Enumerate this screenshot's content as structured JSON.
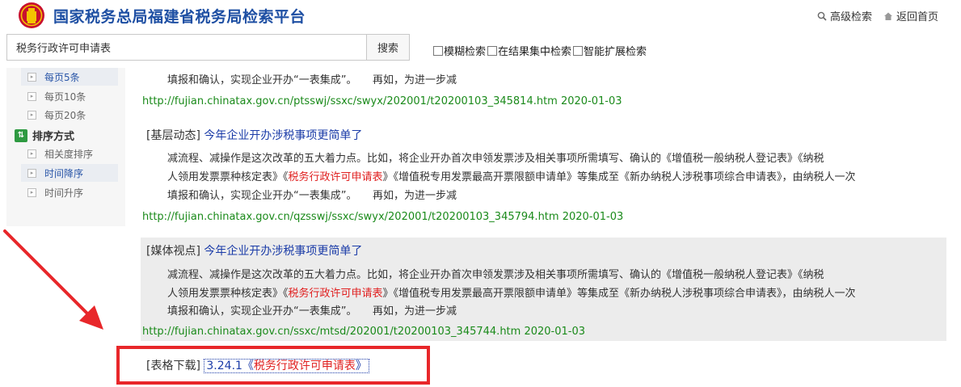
{
  "header": {
    "site_title": "国家税务总局福建省税务局检索平台",
    "advanced_search": "高级检索",
    "back_home": "返回首页"
  },
  "search": {
    "query": "税务行政许可申请表",
    "button": "搜索",
    "options": [
      "模糊检索",
      "在结果集中检索",
      "智能扩展检索"
    ]
  },
  "sidebar": {
    "page_size_items": [
      "每页5条",
      "每页10条",
      "每页20条"
    ],
    "sort_heading": "排序方式",
    "sort_items": [
      "相关度排序",
      "时间降序",
      "时间升序"
    ]
  },
  "results": {
    "first_partial": {
      "snippet_line": "填报和确认，实现企业开办“一表集成”。　　再如，为进一步减",
      "url_date": "http://fujian.chinatax.gov.cn/ptsswj/ssxc/swyx/202001/t20200103_345814.htm 2020-01-03"
    },
    "items": [
      {
        "category": "[基层动态]",
        "title": "今年企业开办涉税事项更简单了",
        "line1": "减流程、减操作是这次改革的五大着力点。比如，将企业开办首次申领发票涉及相关事项所需填写、确认的《增值税一般纳税人登记表》《纳税",
        "line2_a": "人领用发票票种核定表》《",
        "line2_hl": "税务行政许可申请表",
        "line2_b": "》《增值税专用发票最高开票限额申请单》等集成至《新办纳税人涉税事项综合申请表》，由纳税人一次",
        "line3": "填报和确认，实现企业开办“一表集成”。　　再如，为进一步减",
        "url_date": "http://fujian.chinatax.gov.cn/qzsswj/ssxc/swyx/202001/t20200103_345794.htm 2020-01-03"
      },
      {
        "category": "[媒体视点]",
        "title": "今年企业开办涉税事项更简单了",
        "line1": "减流程、减操作是这次改革的五大着力点。比如，将企业开办首次申领发票涉及相关事项所需填写、确认的《增值税一般纳税人登记表》《纳税",
        "line2_a": "人领用发票票种核定表》《",
        "line2_hl": "税务行政许可申请表",
        "line2_b": "》《增值税专用发票最高开票限额申请单》等集成至《新办纳税人涉税事项综合申请表》，由纳税人一次",
        "line3": "填报和确认，实现企业开办“一表集成”。　　再如，为进一步减",
        "url_date": "http://fujian.chinatax.gov.cn/ssxc/mtsd/202001/t20200103_345744.htm 2020-01-03"
      }
    ],
    "download": {
      "category": "[表格下载]",
      "prefix": "3.24.1《",
      "highlight": "税务行政许可申请表",
      "suffix": "》"
    }
  },
  "colors": {
    "title_blue": "#1e4fa3",
    "link_blue": "#1b3ca8",
    "url_green": "#1a8a1a",
    "highlight_red": "#e02020",
    "annotation_red": "#e8272a"
  }
}
